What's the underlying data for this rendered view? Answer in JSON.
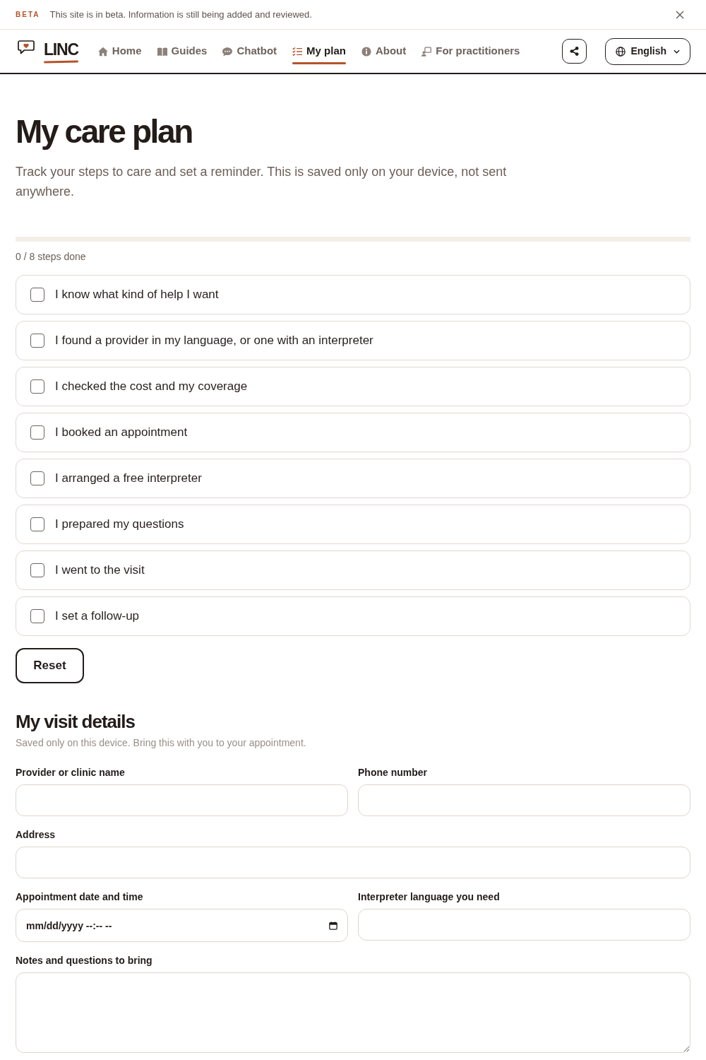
{
  "beta_banner": {
    "badge": "BETA",
    "message": "This site is in beta. Information is still being added and reviewed."
  },
  "navbar": {
    "brand": "LINC",
    "items": [
      {
        "label": "Home",
        "kind": "home",
        "selected": false
      },
      {
        "label": "Guides",
        "kind": "guides",
        "selected": false
      },
      {
        "label": "Chatbot",
        "kind": "chatbot",
        "selected": false
      },
      {
        "label": "My plan",
        "kind": "plan",
        "selected": true
      },
      {
        "label": "About",
        "kind": "about",
        "selected": false
      },
      {
        "label": "For practitioners",
        "kind": "practitioners",
        "selected": false
      }
    ],
    "language_button": "English"
  },
  "care_plan": {
    "title": "My care plan",
    "intro": "Track your steps to care and set a reminder. This is saved only on your device, not sent anywhere.",
    "progress": {
      "level": 0,
      "label": "0 / 8 steps done"
    },
    "steps": [
      {
        "label": "I know what kind of help I want",
        "checked": false
      },
      {
        "label": "I found a provider in my language, or one with an interpreter",
        "checked": false
      },
      {
        "label": "I checked the cost and my coverage",
        "checked": false
      },
      {
        "label": "I booked an appointment",
        "checked": false
      },
      {
        "label": "I arranged a free interpreter",
        "checked": false
      },
      {
        "label": "I prepared my questions",
        "checked": false
      },
      {
        "label": "I went to the visit",
        "checked": false
      },
      {
        "label": "I set a follow-up",
        "checked": false
      }
    ],
    "reset_button": "Reset"
  },
  "visit_details": {
    "title": "My visit details",
    "note": "Saved only on this device. Bring this with you to your appointment.",
    "rows": [
      [
        {
          "label": "Provider or clinic name",
          "kind": "text"
        },
        {
          "label": "Phone number",
          "kind": "text"
        }
      ],
      [
        {
          "label": "Address",
          "kind": "text"
        }
      ],
      [
        {
          "label": "Appointment date and time",
          "kind": "datetime",
          "placeholder": "mm/dd/yyyy --:-- --"
        },
        {
          "label": "Interpreter language you need",
          "kind": "text"
        }
      ],
      [
        {
          "label": "Notes and questions to bring",
          "kind": "textarea"
        }
      ]
    ]
  }
}
